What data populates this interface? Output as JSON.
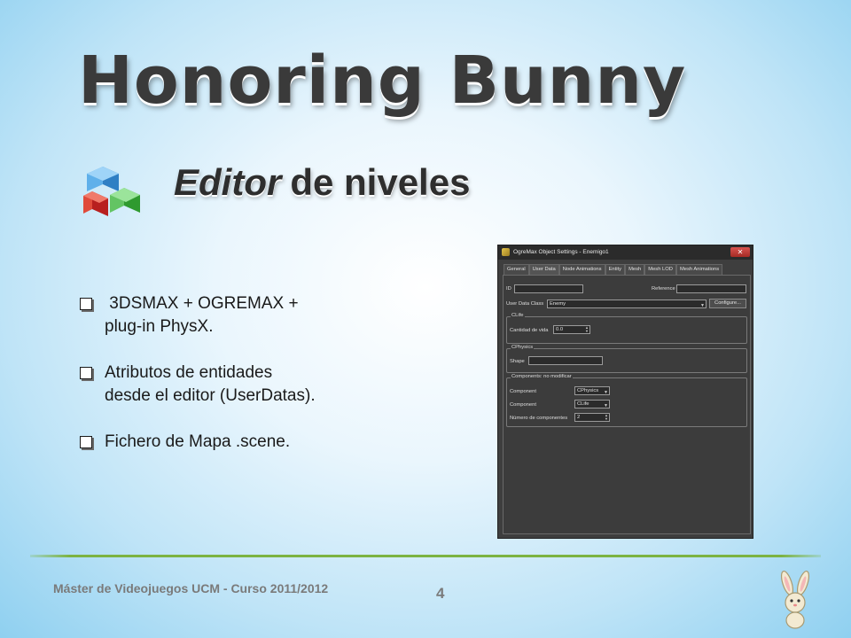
{
  "title": "Honoring Bunny",
  "subtitle": {
    "italic": "Editor",
    "rest": "de niveles"
  },
  "bullets": [
    {
      "line1": " 3DSMAX + OGREMAX +",
      "line2": "plug-in PhysX."
    },
    {
      "line1": "Atributos de entidades",
      "line2": "desde el editor (UserDatas)."
    },
    {
      "line1": "Fichero de Mapa .scene.",
      "line2": ""
    }
  ],
  "window": {
    "title": "OgreMax Object Settings - Enemigo1",
    "tabs": [
      "General",
      "User Data",
      "Node Animations",
      "Entity",
      "Mesh",
      "Mesh LOD",
      "Mesh Animations"
    ],
    "active_tab": "User Data",
    "id_label": "ID",
    "reference_label": "Reference",
    "user_data_class_label": "User Data Class",
    "user_data_class_value": "Enemy",
    "configure_label": "Configure...",
    "clife": {
      "legend": "CLife",
      "field_label": "Cantidad de vida",
      "value": "0.0"
    },
    "cphysics": {
      "legend": "CPhysics",
      "field_label": "Shape"
    },
    "components": {
      "legend": "Components: no modificar",
      "rows": [
        {
          "label": "Component",
          "value": "CPhysics"
        },
        {
          "label": "Component",
          "value": "CLife"
        }
      ],
      "count_label": "Número de componentes",
      "count_value": "2"
    }
  },
  "footer": "Máster de Videojuegos UCM - Curso 2011/2012",
  "page_number": "4",
  "colors": {
    "accent_line": "#7cb342",
    "title": "#3a3a3a",
    "background": "#bfe4f7"
  }
}
